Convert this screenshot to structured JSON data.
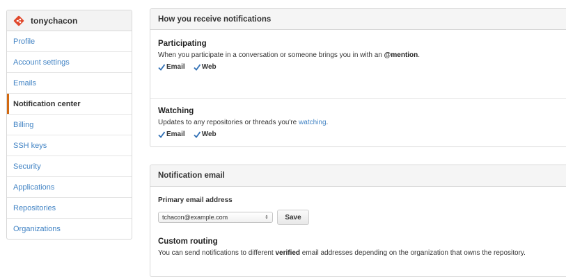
{
  "sidebar": {
    "username": "tonychacon",
    "items": [
      {
        "label": "Profile"
      },
      {
        "label": "Account settings"
      },
      {
        "label": "Emails"
      },
      {
        "label": "Notification center"
      },
      {
        "label": "Billing"
      },
      {
        "label": "SSH keys"
      },
      {
        "label": "Security"
      },
      {
        "label": "Applications"
      },
      {
        "label": "Repositories"
      },
      {
        "label": "Organizations"
      }
    ],
    "active_index": 3
  },
  "notifications": {
    "header": "How you receive notifications",
    "participating": {
      "title": "Participating",
      "desc_prefix": "When you participate in a conversation or someone brings you in with an ",
      "desc_mention": "@mention",
      "desc_suffix": ".",
      "email_label": "Email",
      "web_label": "Web",
      "email_checked": true,
      "web_checked": true
    },
    "watching": {
      "title": "Watching",
      "desc_prefix": "Updates to any repositories or threads you're ",
      "desc_link": "watching",
      "desc_suffix": ".",
      "email_label": "Email",
      "web_label": "Web",
      "email_checked": true,
      "web_checked": true
    }
  },
  "email_panel": {
    "header": "Notification email",
    "primary_label": "Primary email address",
    "selected_email": "tchacon@example.com",
    "save_label": "Save",
    "routing_title": "Custom routing",
    "routing_prefix": "You can send notifications to different ",
    "routing_strong": "verified",
    "routing_suffix": " email addresses depending on the organization that owns the repository."
  },
  "colors": {
    "link": "#4183c4",
    "active_marker": "#d26911",
    "logo": "#e0482c"
  },
  "icons": {
    "logo": "git-logo-icon",
    "check": "checkmark-icon",
    "select_arrows": "select-arrows-icon"
  }
}
